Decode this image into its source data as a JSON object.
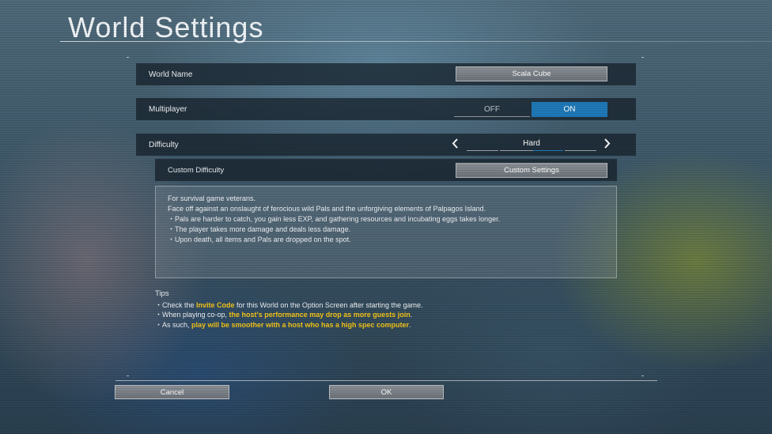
{
  "page": {
    "title": "World Settings"
  },
  "world_name": {
    "label": "World Name",
    "value": "Scala Cube"
  },
  "multiplayer": {
    "label": "Multiplayer",
    "off_label": "OFF",
    "on_label": "ON",
    "selected": "ON"
  },
  "difficulty": {
    "label": "Difficulty",
    "value": "Hard",
    "prev_icon": "chevron-left",
    "next_icon": "chevron-right"
  },
  "custom_difficulty": {
    "label": "Custom Difficulty",
    "button_label": "Custom Settings"
  },
  "description": {
    "lines": [
      "For survival game veterans.",
      "Face off against an onslaught of ferocious wild Pals and the unforgiving elements of Palpagos Island.",
      "・Pals are harder to catch, you gain less EXP, and gathering resources and incubating eggs takes longer.",
      "・The player takes more damage and deals less damage.",
      "・Upon death, all items and Pals are dropped on the spot."
    ]
  },
  "tips": {
    "title": "Tips",
    "tip1": {
      "pre": "・Check the ",
      "hl": "Invite Code",
      "post": " for this World on the Option Screen after starting the game."
    },
    "tip2": {
      "pre": "・When playing co-op, ",
      "hl": "the host's performance may drop as more guests join",
      "post": "."
    },
    "tip3": {
      "pre": "・As such, ",
      "hl": "play will be smoother with a host who has a high spec computer",
      "post": "."
    }
  },
  "footer": {
    "cancel_label": "Cancel",
    "ok_label": "OK"
  },
  "colors": {
    "accent": "#1f79b8",
    "highlight": "#f5c518",
    "row_bg": "#141e28"
  }
}
